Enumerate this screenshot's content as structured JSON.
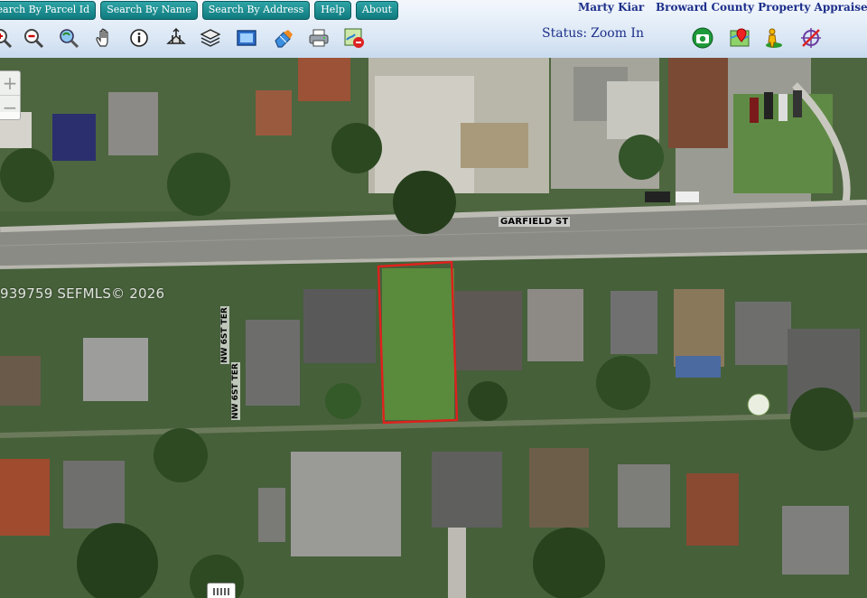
{
  "nav": {
    "buttons": [
      "Search By Parcel Id",
      "Search By Name",
      "Search By Address",
      "Help",
      "About"
    ]
  },
  "header": {
    "owner_name": "Marty Kiar",
    "agency_name": "Broward County Property Appraiser Florida",
    "status_label": "Status:",
    "status_value": "Zoom In"
  },
  "toolbar": {
    "icons": [
      "zoom-in-icon",
      "zoom-out-icon",
      "zoom-extent-icon",
      "pan-hand-icon",
      "info-icon",
      "identify-icon",
      "layers-icon",
      "full-extent-icon",
      "eraser-icon",
      "print-icon",
      "export-map-icon"
    ],
    "right_icons": [
      "camera-icon",
      "map-marker-icon",
      "street-view-icon",
      "clear-selection-icon"
    ]
  },
  "map": {
    "street_name": "GARFIELD ST",
    "vertical_labels": [
      "NW 6ST TER",
      "NW 6ST TER"
    ],
    "watermark": "939759 SEFMLS© 2026",
    "zoom_in": "+",
    "zoom_out": "−"
  },
  "colors": {
    "nav_button": "#0f7a7e",
    "header_text": "#1d2f8a",
    "parcel_outline": "#e0201c"
  }
}
